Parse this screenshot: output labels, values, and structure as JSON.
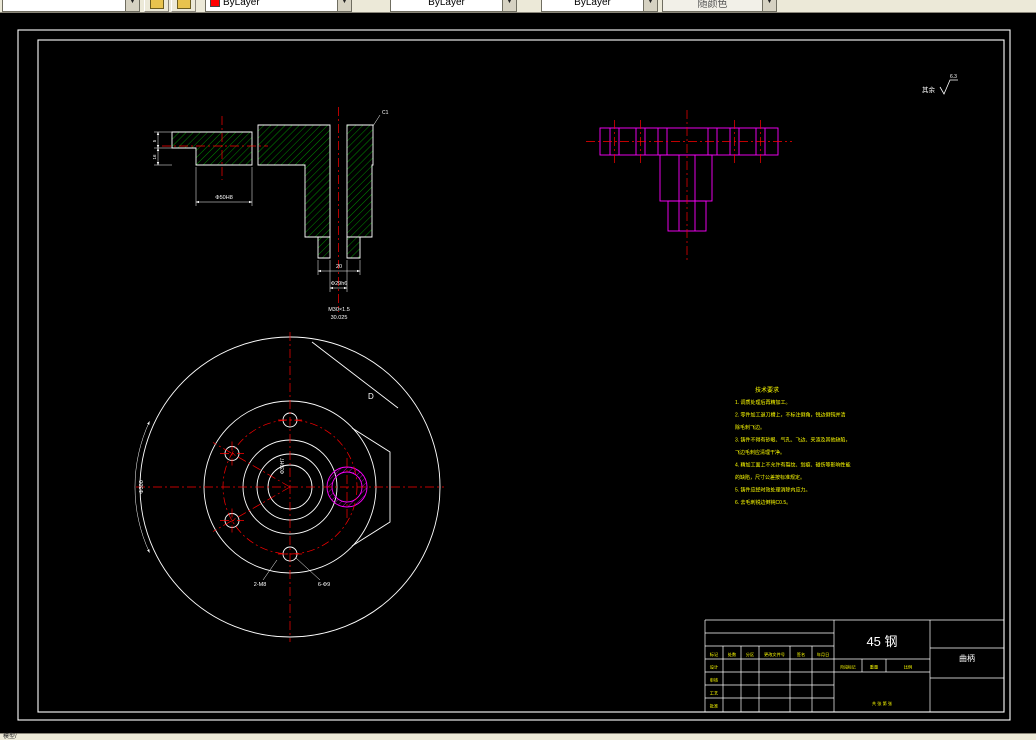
{
  "toolbar": {
    "layer_combo_value": "",
    "color_value": "ByLayer",
    "color_swatch": "#ff0000",
    "linetype_value": "ByLayer",
    "lineweight_value": "ByLayer",
    "plotstyle_value": "随颜色"
  },
  "statusbar": {
    "tabs_label": "模型/"
  },
  "colors": {
    "centerline_red": "#ff0000",
    "hatch_green": "#00c800",
    "highlight_magenta": "#ff00ff",
    "annotation_yellow": "#ffff00",
    "line_white": "#ffffff"
  },
  "drawing": {
    "surface_finish": {
      "label": "其余",
      "value": "6.3"
    },
    "section_view": {
      "dim_h1": "5",
      "dim_h2": "16",
      "dim_flange_bore": "Φ50H8",
      "dim_boss_w": "20",
      "dim_bore": "Φ29h6",
      "dim_thread": "M30×1.5",
      "dim_thread_tol": "30.025",
      "chamfer": "C1"
    },
    "front_view": {
      "label_d": "D",
      "dim_outer": "Φ300",
      "dim_center_bore": "Φ30H7",
      "label_holes_left": "2-M8",
      "label_holes_right": "6-Φ9"
    },
    "notes": {
      "title": "技术要求",
      "lines": [
        "1. 调质处理后再精加工。",
        "2. 零件加工退刀槽上，不标注倒角，锐边倒钝并清",
        "    除毛刺飞边。",
        "3. 铸件不得有砂眼、气孔、飞边、夹渣及其他缺陷，",
        "    飞边毛刺应清理干净。",
        "4. 精加工面上不允许有裂纹、划痕、碰伤等影响性能",
        "    的缺陷，尺寸公差按标准规定。",
        "5. 铸件应经时效处理消除内应力。",
        "6. 去毛刺锐边倒钝C0.5。"
      ]
    },
    "title_block": {
      "material": "45 钢",
      "part_name": "曲柄",
      "header_cells": [
        "标记",
        "处数",
        "分区",
        "更改文件号",
        "签名",
        "年月日"
      ],
      "rows": [
        "设计",
        "审核",
        "工艺",
        "批准"
      ],
      "stage_label": "阶段标记",
      "weight_label": "重量",
      "scale_label": "比例",
      "sheet_label": "共 张 第 张"
    }
  }
}
